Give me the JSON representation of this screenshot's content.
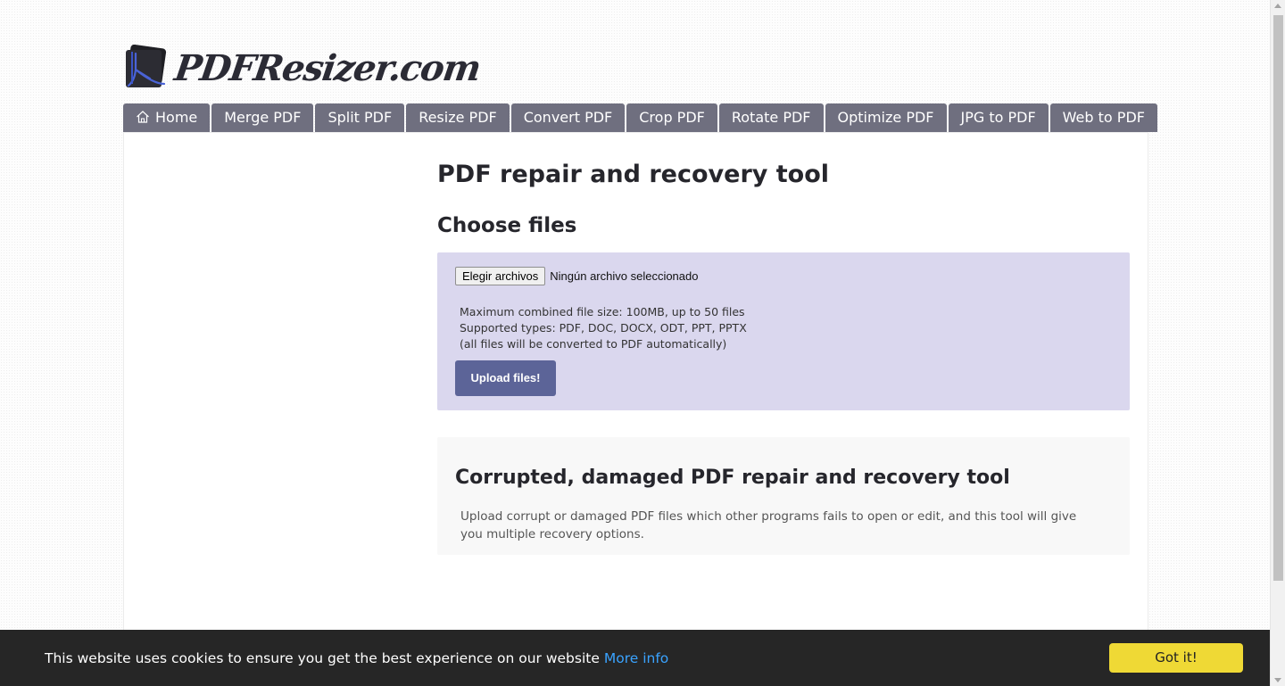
{
  "brand": {
    "name": "PDFResizer.com"
  },
  "nav": {
    "tabs": [
      {
        "label": "Home",
        "icon": "home-icon"
      },
      {
        "label": "Merge PDF"
      },
      {
        "label": "Split PDF"
      },
      {
        "label": "Resize PDF"
      },
      {
        "label": "Convert PDF"
      },
      {
        "label": "Crop PDF"
      },
      {
        "label": "Rotate PDF"
      },
      {
        "label": "Optimize PDF"
      },
      {
        "label": "JPG to PDF"
      },
      {
        "label": "Web to PDF"
      }
    ]
  },
  "main": {
    "title": "PDF repair and recovery tool",
    "choose_title": "Choose files",
    "file_input": {
      "button_label": "Elegir archivos",
      "status": "Ningún archivo seleccionado"
    },
    "limits": [
      "Maximum combined file size: 100MB, up to 50 files",
      "Supported types: PDF, DOC, DOCX, ODT, PPT, PPTX",
      "(all files will be converted to PDF automatically)"
    ],
    "upload_label": "Upload files!",
    "info": {
      "title": "Corrupted, damaged PDF repair and recovery tool",
      "text": "Upload corrupt or damaged PDF files which other programs fails to open or edit, and this tool will give you multiple recovery options."
    }
  },
  "cookie": {
    "message": "This website uses cookies to ensure you get the best experience on our website",
    "more_info": "More info",
    "accept": "Got it!"
  },
  "colors": {
    "nav_tab": "#6f6f7f",
    "upload_box": "#dad7ee",
    "upload_button": "#5c6498",
    "cookie_bar": "#262626",
    "cookie_button": "#efd935",
    "link": "#3aa3ff"
  }
}
